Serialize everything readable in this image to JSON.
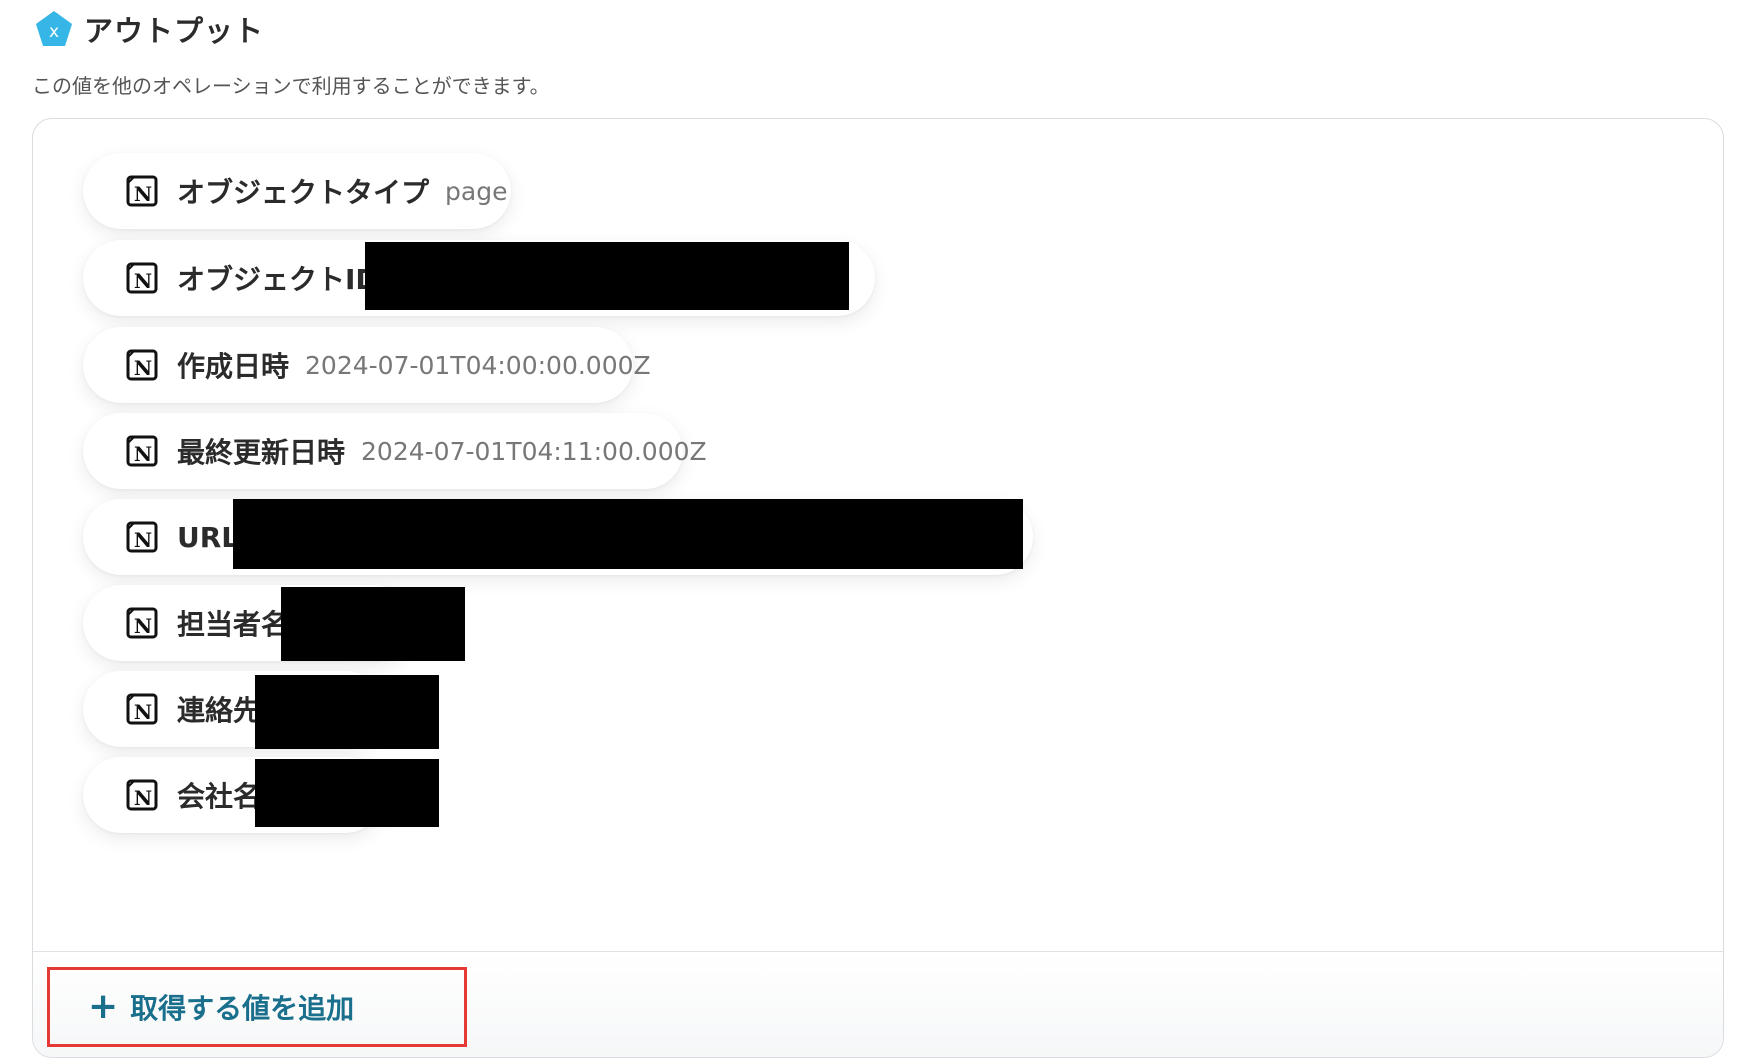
{
  "section": {
    "title": "アウトプット",
    "description": "この値を他のオペレーションで利用することができます。",
    "icon": "variable-x-icon",
    "accent_color": "#35b6e6"
  },
  "outputs": [
    {
      "label": "オブジェクトタイプ",
      "value": "page",
      "redacted": false
    },
    {
      "label": "オブジェクトID",
      "value": "",
      "redacted": true
    },
    {
      "label": "作成日時",
      "value": "2024-07-01T04:00:00.000Z",
      "redacted": false
    },
    {
      "label": "最終更新日時",
      "value": "2024-07-01T04:11:00.000Z",
      "redacted": false
    },
    {
      "label": "URL",
      "value": "",
      "redacted": true
    },
    {
      "label": "担当者名",
      "value": "",
      "redacted": true
    },
    {
      "label": "連絡先",
      "value": "",
      "redacted": true
    },
    {
      "label": "会社名",
      "value": "",
      "redacted": true
    }
  ],
  "chip_icon": "notion-icon",
  "add_button": {
    "label": "取得する値を追加",
    "icon": "plus-icon",
    "color": "#1a6f8c",
    "highlight_color": "#e53935"
  }
}
